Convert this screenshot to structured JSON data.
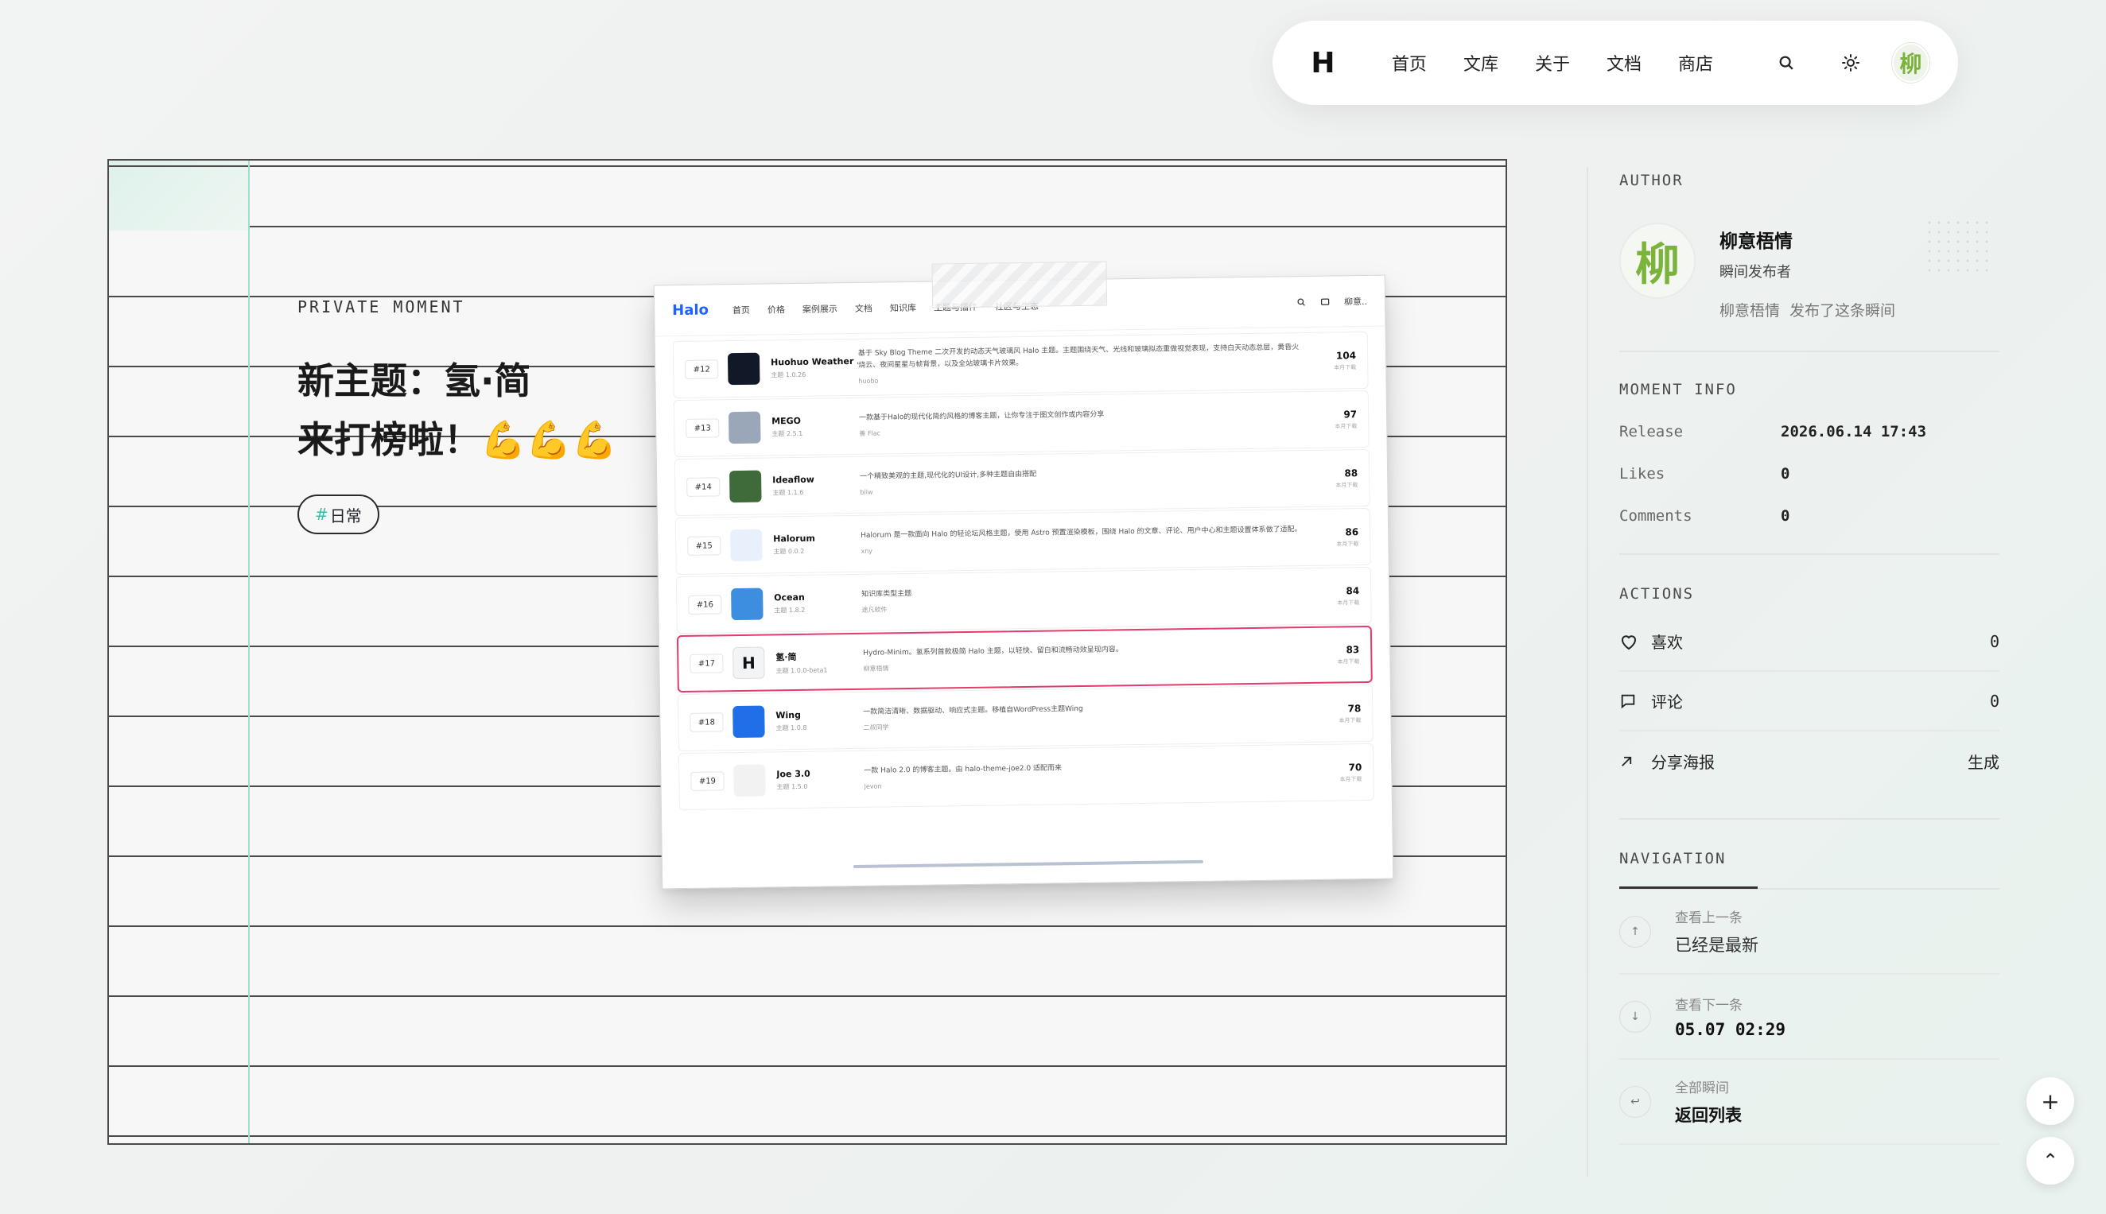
{
  "nav": {
    "logo": "H",
    "links": [
      "首页",
      "文库",
      "关于",
      "文档",
      "商店"
    ],
    "avatar_text": "柳"
  },
  "post": {
    "eyebrow": "PRIVATE MOMENT",
    "title_line1": "新主题：氢·简",
    "title_line2": "来打榜啦！💪💪💪",
    "tag_hash": "#",
    "tag": "日常"
  },
  "screenshot": {
    "logo": "Halo",
    "nav": [
      "首页",
      "价格",
      "案例展示",
      "文档",
      "知识库",
      "主题与插件",
      "社区与生态"
    ],
    "user": "柳意..",
    "rows": [
      {
        "rank": "#12",
        "name": "Huohuo Weather ...",
        "ver": "主题 1.0.26",
        "desc": "基于 Sky Blog Theme 二次开发的动态天气玻璃风 Halo 主题。主题围绕天气、光线和玻璃拟态重做视觉表现，支持白天动态总层，黄昏火烧云、夜间星星与帧背景，以及全站玻璃卡片效果。",
        "author": "huobo",
        "count": "104",
        "unit": "本月下载",
        "thumb": "#111827"
      },
      {
        "rank": "#13",
        "name": "MEGO",
        "ver": "主题 2.5.1",
        "desc": "一款基于Halo的现代化简约风格的博客主题，让你专注于图文创作或内容分享",
        "author": "善 Flac",
        "count": "97",
        "unit": "本月下载",
        "thumb": "#9aa7b8"
      },
      {
        "rank": "#14",
        "name": "Ideaflow",
        "ver": "主题 1.1.6",
        "desc": "一个精致美观的主题,现代化的UI设计,多种主题自由搭配",
        "author": "bilw",
        "count": "88",
        "unit": "本月下载",
        "thumb": "#3f6b3a"
      },
      {
        "rank": "#15",
        "name": "Halorum",
        "ver": "主题 0.0.2",
        "desc": "Halorum 是一款面向 Halo 的轻论坛风格主题，使用 Astro 预置渲染模板，围绕 Halo 的文章、评论、用户中心和主题设置体系做了适配。",
        "author": "xny",
        "count": "86",
        "unit": "本月下载",
        "thumb": "#e8f1fb"
      },
      {
        "rank": "#16",
        "name": "Ocean",
        "ver": "主题 1.8.2",
        "desc": "知识库类型主题",
        "author": "途凡软件",
        "count": "84",
        "unit": "本月下载",
        "thumb": "#3d8de0"
      },
      {
        "rank": "#17",
        "name": "氢·简",
        "ver": "主题 1.0.0-beta1",
        "desc": "Hydro-Minim。氢系列首款极简 Halo 主题，以轻快、留白和流畅动效呈现内容。",
        "author": "柳意梧情",
        "count": "83",
        "unit": "本月下载",
        "thumb": "#f3f4f6",
        "highlight": true
      },
      {
        "rank": "#18",
        "name": "Wing",
        "ver": "主题 1.0.8",
        "desc": "一款简洁清晰、数据驱动、响应式主题。移植自WordPress主题Wing",
        "author": "二叔同学",
        "count": "78",
        "unit": "本月下载",
        "thumb": "#1f6fe8"
      },
      {
        "rank": "#19",
        "name": "Joe 3.0",
        "ver": "主题 1.5.0",
        "desc": "一款 Halo 2.0 的博客主题。由 halo-theme-joe2.0 适配而来",
        "author": "Jevon",
        "count": "70",
        "unit": "本月下载",
        "thumb": "#f2f2f2"
      }
    ]
  },
  "sidebar": {
    "author_header": "AUTHOR",
    "author_avatar": "柳",
    "author_name": "柳意梧情",
    "author_role": "瞬间发布者",
    "author_act_name": "柳意梧情",
    "author_act_text": "发布了这条瞬间",
    "info_header": "MOMENT INFO",
    "info": [
      {
        "k": "Release",
        "v": "2026.06.14 17:43"
      },
      {
        "k": "Likes",
        "v": "0"
      },
      {
        "k": "Comments",
        "v": "0"
      }
    ],
    "actions_header": "ACTIONS",
    "actions": [
      {
        "label": "喜欢",
        "value": "0"
      },
      {
        "label": "评论",
        "value": "0"
      },
      {
        "label": "分享海报",
        "value": "生成"
      }
    ],
    "nav_header": "NAVIGATION",
    "navs": [
      {
        "small": "查看上一条",
        "big": "已经是最新",
        "arrow": "↑"
      },
      {
        "small": "查看下一条",
        "big": "05.07 02:29",
        "arrow": "↓"
      },
      {
        "small": "全部瞬间",
        "big": "返回列表",
        "arrow": "↩"
      }
    ]
  },
  "float": {
    "plus": "+",
    "up": "⌃"
  }
}
